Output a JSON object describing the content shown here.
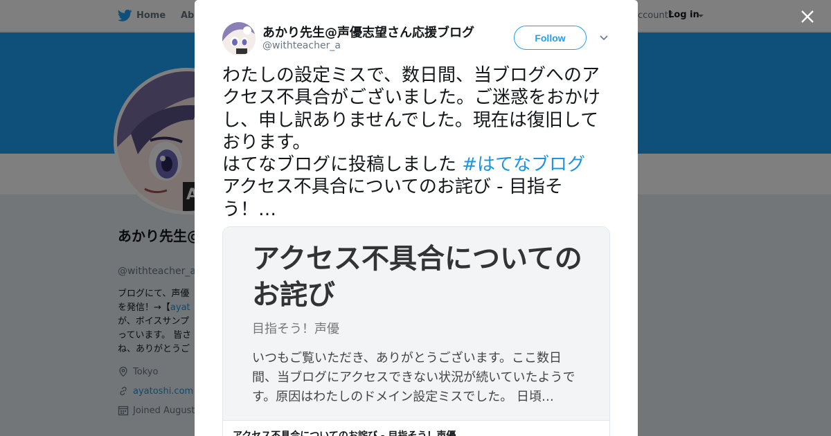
{
  "topbar": {
    "home_label": "Home",
    "about_label": "Abo",
    "account_prompt": "ccount?",
    "login_label": "Log in"
  },
  "profile": {
    "name": "あかり先生@声優志望さん応援ブログ",
    "handle": "@withteacher_a",
    "bio_part1": "ブログにて、声優",
    "bio_part2": "を発信！→【",
    "bio_link": "ayat",
    "bio_part3": "が、ボイスサンプ",
    "bio_part4": "っています。 皆さ",
    "bio_part5": "ね、ありがとうご",
    "location": "Tokyo",
    "website": "ayatoshi.com",
    "joined": "Joined August"
  },
  "tweet": {
    "author_name": "あかり先生@声優志望さん応援ブログ",
    "author_handle": "@withteacher_a",
    "follow_label": "Follow",
    "text_main": "わたしの設定ミスで、数日間、当ブログへのアクセス不具合がございました。ご迷惑をおかけし、申し訳ありませんでした。現在は復旧しております。\nはてなブログに投稿しました ",
    "hashtag": "#はてなブログ",
    "text_after": "\nアクセス不具合についてのお詫び - 目指そう！…",
    "card": {
      "image_title": "アクセス不具合についてのお詫び",
      "image_site": "目指そう！声優",
      "image_desc": "いつもご覧いただき、ありがとうございます。ここ数日間、当ブログにアクセスできない状況が続いていたようです。原因はわたしのドメイン設定ミスでした。 日頃…",
      "title": "アクセス不具合についてのお詫び - 目指そう！声優"
    }
  },
  "icons": [
    "twitter-bird-icon",
    "login-caret-icon",
    "close-icon",
    "tweet-menu-caret-icon",
    "location-icon",
    "link-icon",
    "calendar-icon"
  ],
  "colors": {
    "brand_blue": "#1da1f2",
    "link_blue": "#1b95e0",
    "overlay": "rgba(0,0,0,0.5)"
  }
}
